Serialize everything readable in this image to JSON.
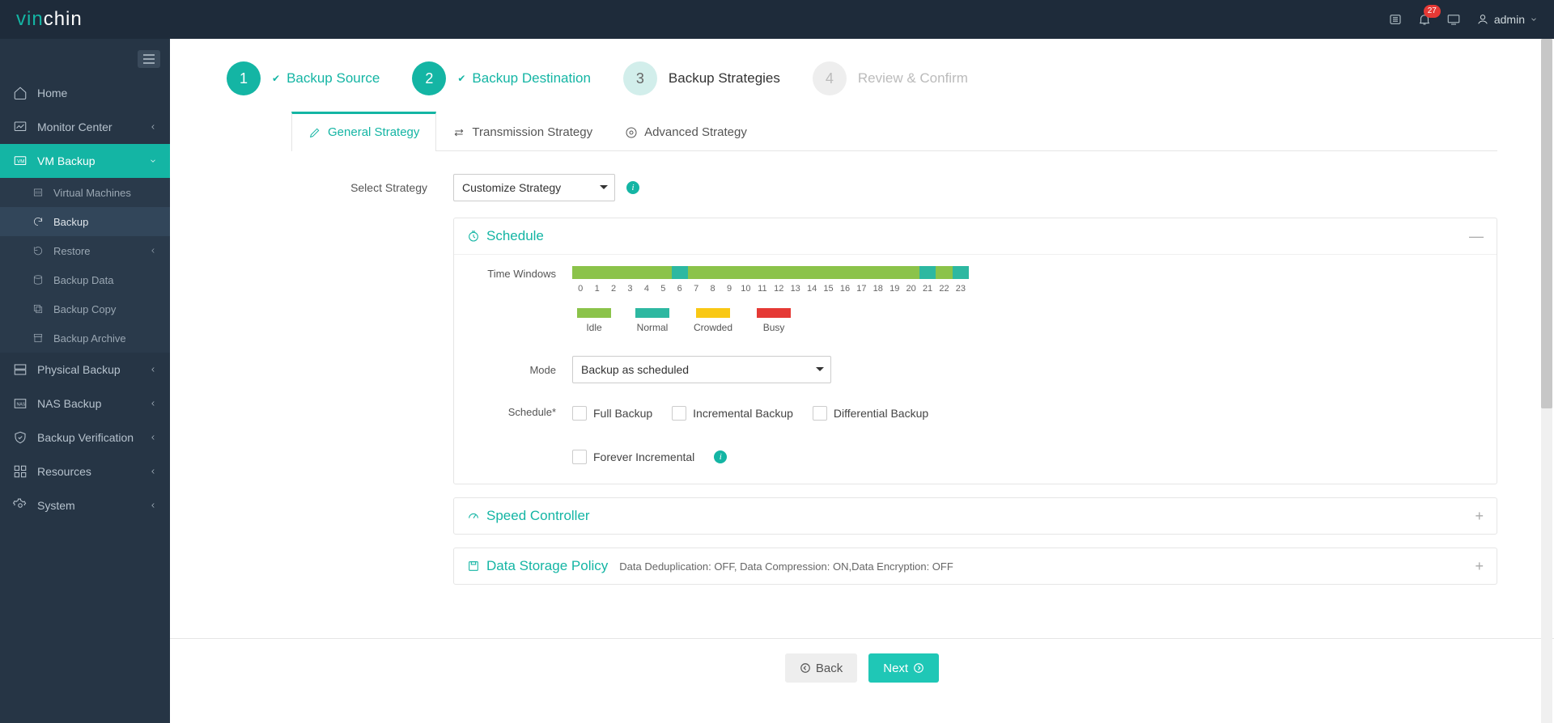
{
  "brand": {
    "part1": "vin",
    "part2": "chin"
  },
  "topbar": {
    "notif_count": "27",
    "username": "admin"
  },
  "sidebar": {
    "items": [
      {
        "label": "Home"
      },
      {
        "label": "Monitor Center"
      },
      {
        "label": "VM Backup"
      },
      {
        "label": "Physical Backup"
      },
      {
        "label": "NAS Backup"
      },
      {
        "label": "Backup Verification"
      },
      {
        "label": "Resources"
      },
      {
        "label": "System"
      }
    ],
    "vm_sub": [
      {
        "label": "Virtual Machines"
      },
      {
        "label": "Backup"
      },
      {
        "label": "Restore"
      },
      {
        "label": "Backup Data"
      },
      {
        "label": "Backup Copy"
      },
      {
        "label": "Backup Archive"
      }
    ]
  },
  "steps": [
    {
      "num": "1",
      "label": "Backup Source"
    },
    {
      "num": "2",
      "label": "Backup Destination"
    },
    {
      "num": "3",
      "label": "Backup Strategies"
    },
    {
      "num": "4",
      "label": "Review & Confirm"
    }
  ],
  "tabs": [
    {
      "label": "General Strategy"
    },
    {
      "label": "Transmission Strategy"
    },
    {
      "label": "Advanced Strategy"
    }
  ],
  "form": {
    "select_strategy_label": "Select Strategy",
    "select_strategy_value": "Customize Strategy"
  },
  "schedule": {
    "title": "Schedule",
    "time_windows_label": "Time Windows",
    "hours": [
      "0",
      "1",
      "2",
      "3",
      "4",
      "5",
      "6",
      "7",
      "8",
      "9",
      "10",
      "11",
      "12",
      "13",
      "14",
      "15",
      "16",
      "17",
      "18",
      "19",
      "20",
      "21",
      "22",
      "23"
    ],
    "segments": [
      {
        "cls": "c-idle",
        "w": 6
      },
      {
        "cls": "c-normal",
        "w": 1
      },
      {
        "cls": "c-idle",
        "w": 14
      },
      {
        "cls": "c-normal",
        "w": 1
      },
      {
        "cls": "c-idle",
        "w": 1
      },
      {
        "cls": "c-normal",
        "w": 1
      }
    ],
    "legend": [
      {
        "label": "Idle",
        "cls": "c-idle"
      },
      {
        "label": "Normal",
        "cls": "c-normal"
      },
      {
        "label": "Crowded",
        "cls": "c-crowded"
      },
      {
        "label": "Busy",
        "cls": "c-busy"
      }
    ],
    "mode_label": "Mode",
    "mode_value": "Backup as scheduled",
    "schedule_label": "Schedule",
    "opts": {
      "full": "Full Backup",
      "incremental": "Incremental Backup",
      "differential": "Differential Backup",
      "forever": "Forever Incremental"
    }
  },
  "speed": {
    "title": "Speed Controller"
  },
  "storage": {
    "title": "Data Storage Policy",
    "summary": "Data Deduplication: OFF, Data Compression: ON,Data Encryption: OFF"
  },
  "footer": {
    "back": "Back",
    "next": "Next"
  }
}
